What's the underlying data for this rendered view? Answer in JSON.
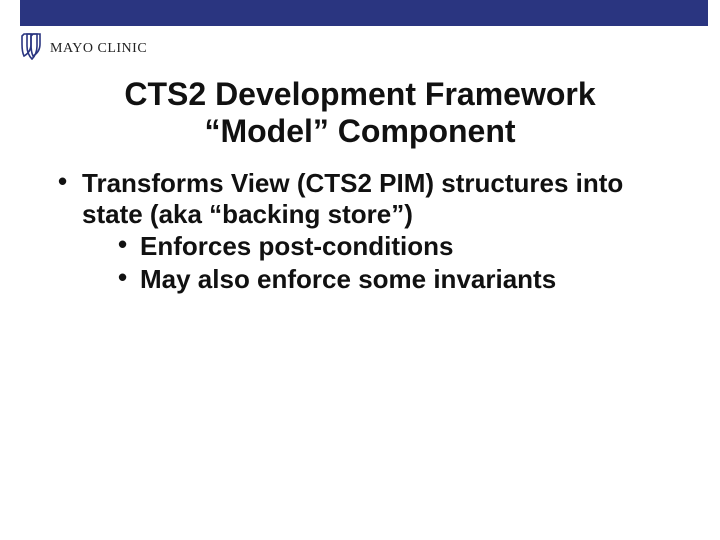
{
  "header": {
    "brand": "MAYO CLINIC"
  },
  "title": {
    "line1": "CTS2 Development Framework",
    "line2": "“Model” Component"
  },
  "bullets": {
    "item1": "Transforms View (CTS2 PIM) structures into state (aka “backing store”)",
    "sub1": "Enforces post-conditions",
    "sub2": "May also enforce some invariants"
  }
}
